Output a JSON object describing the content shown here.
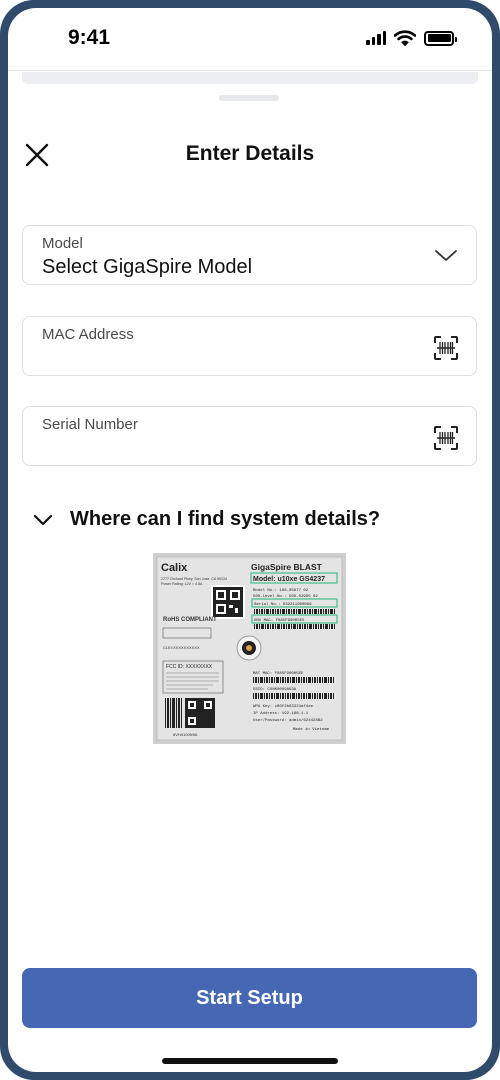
{
  "status_bar": {
    "time": "9:41"
  },
  "sheet": {
    "title": "Enter Details",
    "fields": {
      "model": {
        "label": "Model",
        "value": "Select GigaSpire Model"
      },
      "mac": {
        "label": "MAC Address",
        "value": ""
      },
      "serial": {
        "label": "Serial Number",
        "value": ""
      }
    },
    "help": {
      "label": "Where can I find system details?"
    },
    "device_label": {
      "brand": "Calix",
      "product": "GigaSpire BLAST",
      "model_line": "Model: u10xe GS4237",
      "address": "2777 Orchard Pkwy, San Jose, CA 95134",
      "power": "Power Rating: 12V = 4.5A",
      "rohs": "RoHS COMPLIANT",
      "model_no": "Model No.: 100-05877 02",
      "sub_level": "500-Level No.: 500-02995 02",
      "serial_no": "Serial No.: 032211000096",
      "onu_mac": "ONU MAC: F885F90005E5",
      "mat_mac": "MAT MAC: F885F90005EE",
      "ssid": "SSID: CXNK0009863A",
      "wpa": "WPA Key: c80f2b83324af4ee",
      "ip": "IP Address: 192.168.1.1",
      "user_pass": "User/Password: admin/624428B2",
      "made_in": "Made in Vietnam",
      "fcc": "FCC ID: XXXXXXXX",
      "clei": "CLEI:XXXXXXXXXX",
      "bottom_code": "8VH4100N9A"
    },
    "start_button": "Start Setup"
  },
  "colors": {
    "primary": "#4667b4",
    "frame": "#2f4a6b",
    "border": "#dcdfe4"
  },
  "icons": {
    "close": "close-icon",
    "dropdown": "chevron-down-icon",
    "scan": "barcode-scan-icon",
    "expand": "chevron-down-icon"
  }
}
